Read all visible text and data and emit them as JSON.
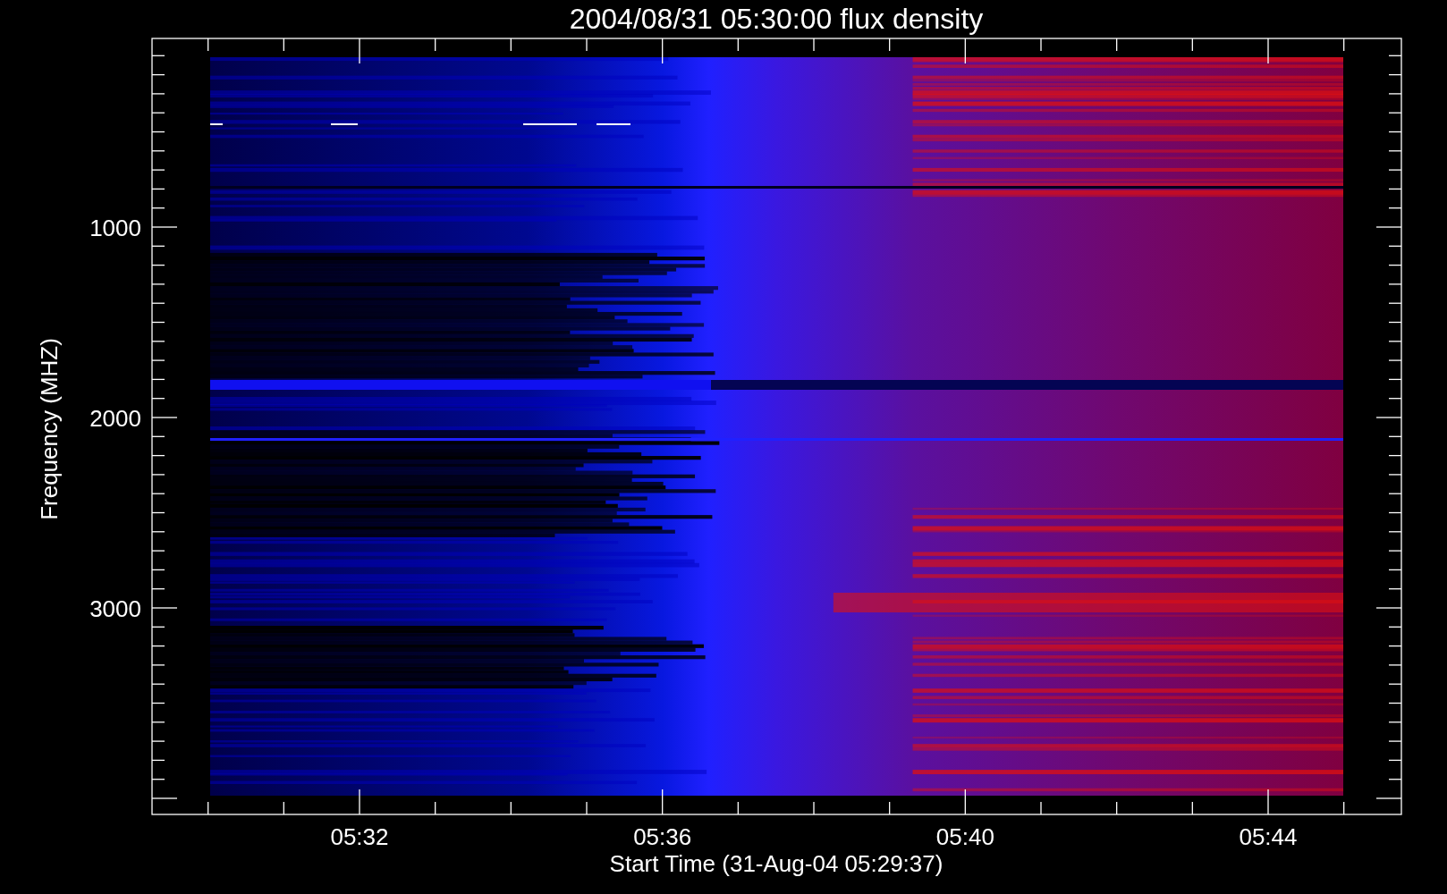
{
  "title": "2004/08/31 05:30:00 flux density",
  "y_axis": {
    "label": "Frequency (MHZ)",
    "ticks": [
      "1000",
      "2000",
      "3000"
    ]
  },
  "x_axis": {
    "label": "Start Time (31-Aug-04 05:29:37)",
    "ticks": [
      "05:32",
      "05:36",
      "05:40",
      "05:44"
    ]
  }
}
